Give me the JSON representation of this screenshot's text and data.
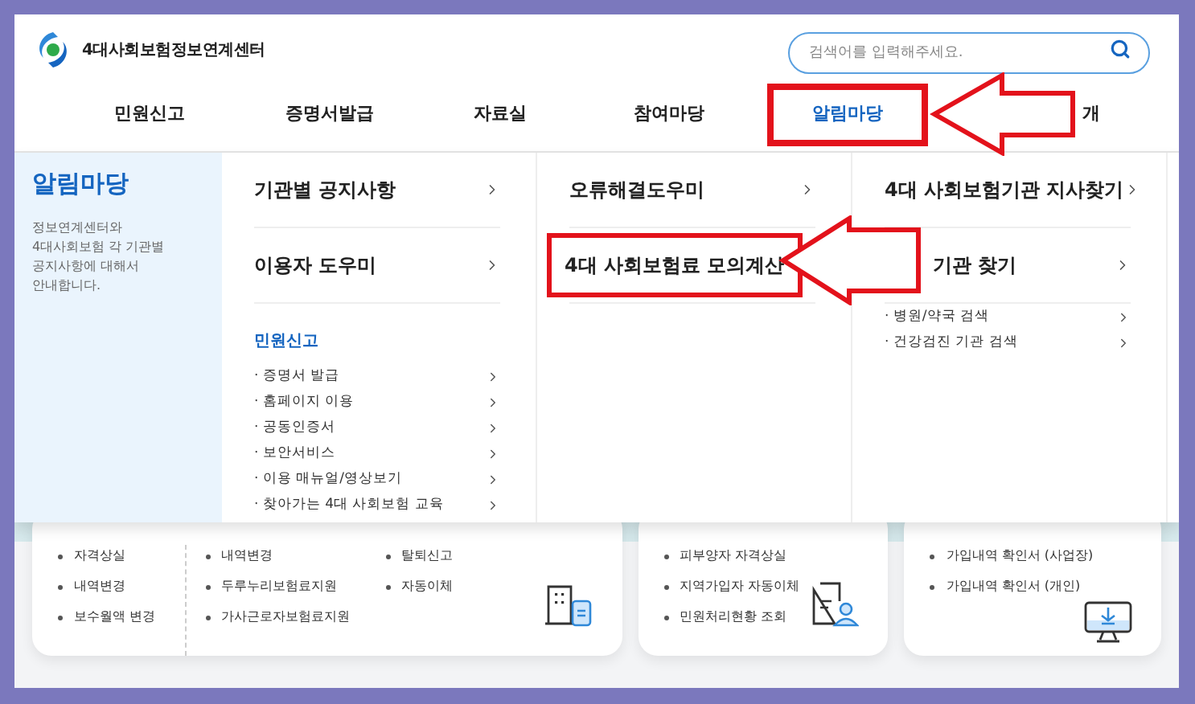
{
  "logo": {
    "text": "4대사회보험정보연계센터"
  },
  "search": {
    "placeholder": "검색어를 입력해주세요."
  },
  "nav": [
    {
      "label": "민원신고",
      "selected": false,
      "highlighted": false
    },
    {
      "label": "증명서발급",
      "selected": false,
      "highlighted": false
    },
    {
      "label": "자료실",
      "selected": false,
      "highlighted": false
    },
    {
      "label": "참여마당",
      "selected": false,
      "highlighted": false
    },
    {
      "label": "알림마당",
      "selected": true,
      "highlighted": true
    },
    {
      "label": "개",
      "selected": false,
      "highlighted": false
    }
  ],
  "menu": {
    "title": "알림마당",
    "description": "정보연계센터와\n4대사회보험 각 기관별\n공지사항에 대해서\n안내합니다.",
    "columns": [
      {
        "items": [
          {
            "kind": "link",
            "label": "기관별 공지사항",
            "highlighted": false
          },
          {
            "kind": "link",
            "label": "이용자 도우미",
            "highlighted": false
          },
          {
            "kind": "heading",
            "label": "민원신고"
          },
          {
            "kind": "sub",
            "label": "· 증명서 발급"
          },
          {
            "kind": "sub",
            "label": "· 홈페이지 이용"
          },
          {
            "kind": "sub",
            "label": "· 공동인증서"
          },
          {
            "kind": "sub",
            "label": "· 보안서비스"
          },
          {
            "kind": "sub",
            "label": "· 이용 매뉴얼/영상보기"
          },
          {
            "kind": "sub",
            "label": "· 찾아가는 4대 사회보험 교육"
          }
        ]
      },
      {
        "items": [
          {
            "kind": "link",
            "label": "오류해결도우미",
            "highlighted": false
          },
          {
            "kind": "link",
            "label": "4대 사회보험료 모의계산",
            "highlighted": true
          }
        ]
      },
      {
        "items": [
          {
            "kind": "link",
            "label": "4대 사회보험기관 지사찾기",
            "highlighted": false
          },
          {
            "kind": "partial",
            "label": "기관 찾기",
            "highlighted": false
          },
          {
            "kind": "sub",
            "label": "· 병원/약국 검색"
          },
          {
            "kind": "sub",
            "label": "· 건강검진 기관 검색"
          }
        ]
      }
    ]
  },
  "cards": [
    {
      "kind": "building",
      "groups": [
        [
          [
            "자격상실",
            "내역변경",
            "보수월액 변경"
          ]
        ],
        [
          [
            "내역변경",
            "두루누리보험료지원",
            "가사근로자보험료지원"
          ],
          [
            "탈퇴신고",
            "자동이체"
          ]
        ]
      ]
    },
    {
      "kind": "person",
      "groups": [
        [
          [
            "피부양자 자격상실",
            "지역가입자 자동이체",
            "민원처리현황 조회"
          ]
        ]
      ]
    },
    {
      "kind": "monitor",
      "groups": [
        [
          [
            "가입내역 확인서 (사업장)",
            "가입내역 확인서 (개인)"
          ]
        ]
      ]
    }
  ]
}
